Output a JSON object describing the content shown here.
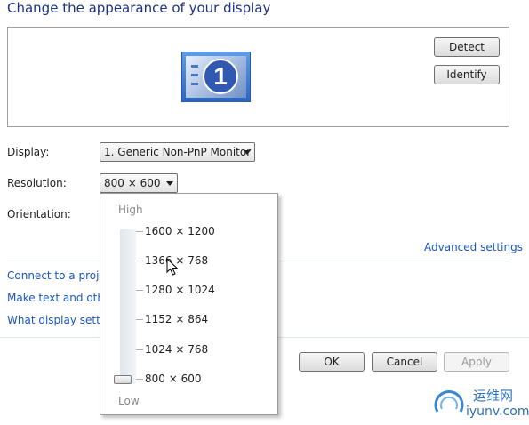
{
  "heading": "Change the appearance of your display",
  "preview": {
    "monitor_number": "1",
    "detect_label": "Detect",
    "identify_label": "Identify"
  },
  "form": {
    "display_label": "Display:",
    "display_value": "1. Generic Non-PnP Monitor",
    "resolution_label": "Resolution:",
    "resolution_value": "800 × 600",
    "orientation_label": "Orientation:"
  },
  "links": {
    "advanced": "Advanced settings",
    "connect": "Connect to a projec",
    "make_text": "Make text and other",
    "what_display": "What display setting"
  },
  "resolution_popup": {
    "high_label": "High",
    "low_label": "Low",
    "options": [
      "1600 × 1200",
      "1366 × 768",
      "1280 × 1024",
      "1152 × 864",
      "1024 × 768",
      "800 × 600"
    ],
    "selected": "800 × 600"
  },
  "buttons": {
    "ok": "OK",
    "cancel": "Cancel",
    "apply": "Apply"
  },
  "watermark": {
    "line1": "运维网",
    "line2": "iyunv.com"
  },
  "colors": {
    "title": "#1e3287",
    "link": "#1a57c0",
    "monitor_blue": "#2f59b3"
  }
}
